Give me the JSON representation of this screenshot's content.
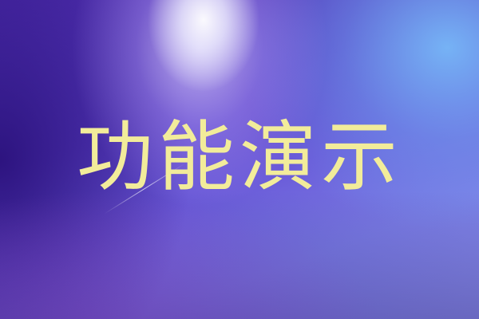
{
  "banner": {
    "title": "功能演示",
    "title_color": "#f2ec9a"
  }
}
